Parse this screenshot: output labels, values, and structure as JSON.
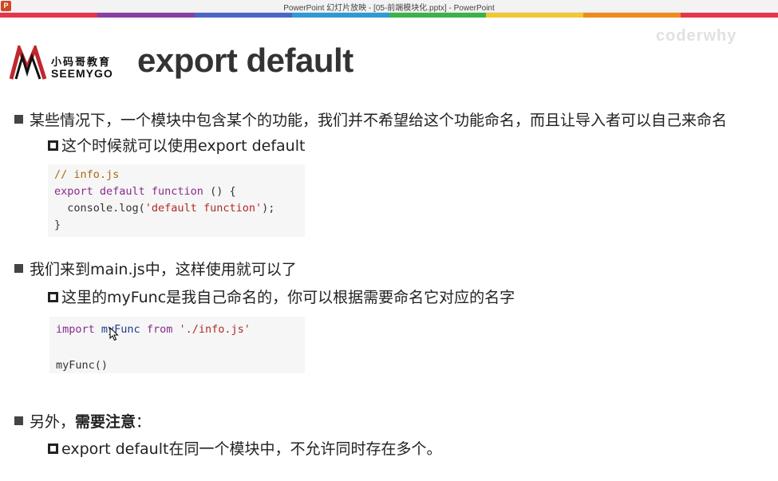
{
  "window": {
    "title": "PowerPoint 幻灯片放映 - [05-前端模块化.pptx] - PowerPoint",
    "app_icon": "P"
  },
  "colors": {
    "rainbow": [
      "#e6344a",
      "#8a3fa4",
      "#4a64c8",
      "#2d9ad6",
      "#3ab24a",
      "#f0c830",
      "#f08a1c",
      "#e6344a"
    ]
  },
  "logo": {
    "cn": "小码哥教育",
    "en": "SEEMYGO"
  },
  "watermark": "coderwhy",
  "slide": {
    "title": "export default",
    "bullets": [
      {
        "text": "某些情况下，一个模块中包含某个的功能，我们并不希望给这个功能命名，而且让导入者可以自己来命名"
      },
      {
        "text": "这个时候就可以使用export default"
      },
      {
        "text": "我们来到main.js中，这样使用就可以了"
      },
      {
        "text": "这里的myFunc是我自己命名的，你可以根据需要命名它对应的名字"
      },
      {
        "text_plain": "另外，",
        "text_bold": "需要注意",
        "text_tail": "："
      },
      {
        "text": "export default在同一个模块中，不允许同时存在多个。"
      }
    ],
    "code1": {
      "comment": "// info.js",
      "l2_kw": "export default function",
      "l2_rest": " () {",
      "l3_a": "  console.log(",
      "l3_str": "'default function'",
      "l3_b": ");",
      "l4": "}"
    },
    "code2": {
      "kw1": "import",
      "name": " myFunc ",
      "kw2": "from",
      "str": " './info.js'",
      "l3": "myFunc()"
    }
  }
}
